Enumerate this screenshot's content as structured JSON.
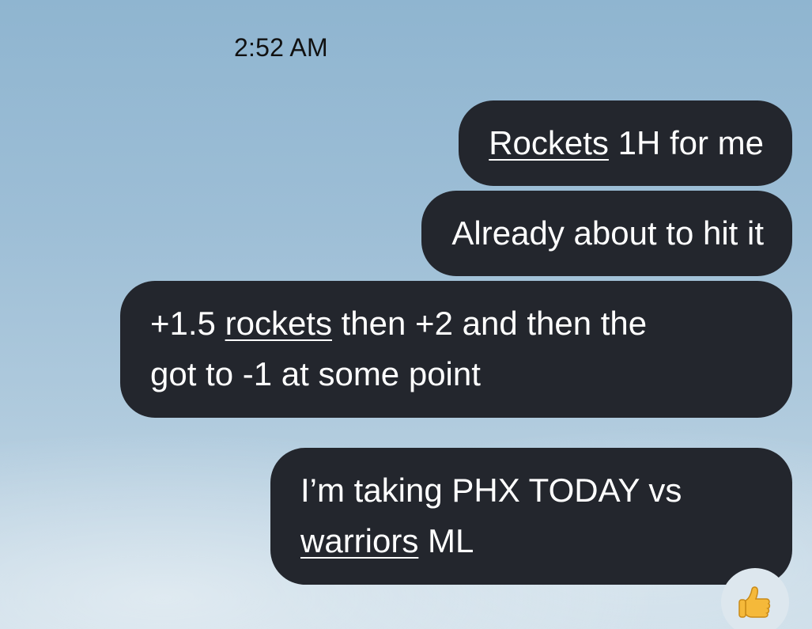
{
  "timestamp": "2:52 AM",
  "messages": [
    {
      "line1": {
        "u": "Rockets",
        "rest": " 1H for me"
      }
    },
    {
      "line1": {
        "text": "Already about to hit it"
      }
    },
    {
      "line1": {
        "pre": "+1.5 ",
        "u": "rockets",
        "rest": " then +2 and then the"
      },
      "line2": {
        "text": "got to -1 at some point"
      }
    },
    {
      "line1": {
        "text": "I’m taking PHX TODAY vs"
      },
      "line2": {
        "u": "warriors",
        "rest": " ML"
      }
    }
  ],
  "reaction": {
    "icon": "thumbs-up-icon",
    "color": "#f5b93a"
  },
  "colors": {
    "bubble": "#23262d",
    "bubble_text": "#ffffff",
    "timestamp": "#111111"
  }
}
